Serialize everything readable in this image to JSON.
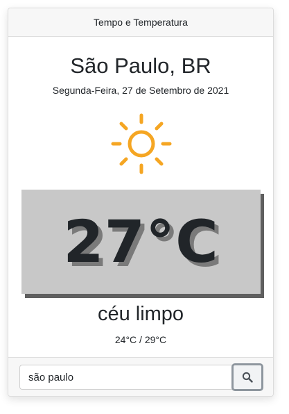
{
  "header": {
    "title": "Tempo e Temperatura"
  },
  "weather": {
    "location": "São Paulo, BR",
    "date": "Segunda-Feira, 27 de Setembro de 2021",
    "icon": "sun-icon",
    "icon_color": "#f5a623",
    "temperature": "27°C",
    "description": "céu limpo",
    "min_max": "24°C / 29°C"
  },
  "search": {
    "value": "são paulo",
    "button_icon": "search-icon"
  }
}
